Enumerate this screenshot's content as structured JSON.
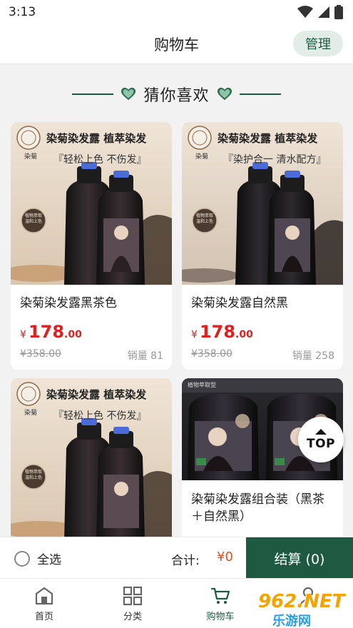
{
  "status_bar": {
    "time": "3:13"
  },
  "header": {
    "title": "购物车",
    "manage_label": "管理"
  },
  "section": {
    "title": "猜你喜欢"
  },
  "products": [
    {
      "banner_title": "染菊染发露 植萃染发",
      "banner_slogan": "『轻松上色  不伤发』",
      "brand": "染菊",
      "seal_text": "植物萃取 温和上色",
      "name": "染菊染发露黑茶色",
      "price_currency": "¥",
      "price_int": "178",
      "price_dec": ".00",
      "original_price": "¥358.00",
      "sales": "销量 81"
    },
    {
      "banner_title": "染菊染发露 植萃染发",
      "banner_slogan": "『染护合一  清水配方』",
      "brand": "染菊",
      "seal_text": "植物萃取 温和上色",
      "name": "染菊染发露自然黑",
      "price_currency": "¥",
      "price_int": "178",
      "price_dec": ".00",
      "original_price": "¥358.00",
      "sales": "销量 258"
    },
    {
      "banner_title": "染菊染发露 植萃染发",
      "banner_slogan": "『轻松上色  不伤发』",
      "brand": "染菊",
      "seal_text": "植物萃取 温和上色",
      "name": ""
    },
    {
      "banner_title": "植物萃取型",
      "name_line1": "染菊染发露组合装（黑茶",
      "name_line2": "＋自然黑）"
    }
  ],
  "top_button": {
    "label": "TOP"
  },
  "checkout": {
    "select_all_label": "全选",
    "total_label": "合计:",
    "total_value": "¥0",
    "checkout_label": "结算 (0)"
  },
  "tabs": [
    {
      "label": "首页",
      "icon": "home-icon"
    },
    {
      "label": "分类",
      "icon": "category-icon"
    },
    {
      "label": "购物车",
      "icon": "cart-icon",
      "active": true
    },
    {
      "label": "",
      "icon": "profile-icon"
    }
  ],
  "watermark": {
    "big": "962.NET",
    "small": "乐游网"
  },
  "colors": {
    "brand_green": "#1e5a42",
    "price_red": "#e02020",
    "manage_bg": "#e3ede8"
  }
}
